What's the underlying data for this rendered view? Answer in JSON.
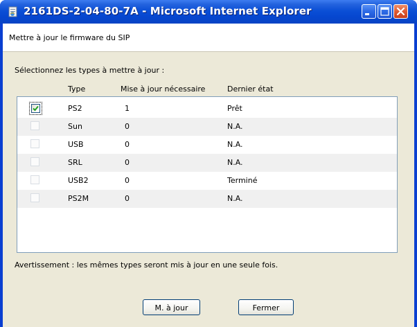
{
  "window": {
    "title": "2161DS-2-04-80-7A - Microsoft Internet Explorer",
    "title_icon": "ie-page-icon",
    "controls": {
      "minimize": "minimize-icon",
      "maximize": "maximize-icon",
      "close": "close-icon"
    }
  },
  "header": {
    "title": "Mettre à jour le firmware du SIP"
  },
  "prompt": "Sélectionnez les types à mettre à jour :",
  "columns": {
    "type": "Type",
    "update_needed": "Mise à jour nécessaire",
    "last_state": "Dernier état"
  },
  "rows": [
    {
      "checked": true,
      "type": "PS2",
      "update_needed": "1",
      "last_state": "Prêt"
    },
    {
      "checked": false,
      "type": "Sun",
      "update_needed": "0",
      "last_state": "N.A."
    },
    {
      "checked": false,
      "type": "USB",
      "update_needed": "0",
      "last_state": "N.A."
    },
    {
      "checked": false,
      "type": "SRL",
      "update_needed": "0",
      "last_state": "N.A."
    },
    {
      "checked": false,
      "type": "USB2",
      "update_needed": "0",
      "last_state": "Terminé"
    },
    {
      "checked": false,
      "type": "PS2M",
      "update_needed": "0",
      "last_state": "N.A."
    }
  ],
  "warning": "Avertissement : les mêmes types seront mis à jour en une seule fois.",
  "buttons": {
    "update": "M. à jour",
    "close": "Fermer"
  },
  "colors": {
    "titlebar": "#0647d0",
    "client": "#ece9d8",
    "checkmark": "#21a121",
    "close_button": "#df5a32"
  }
}
